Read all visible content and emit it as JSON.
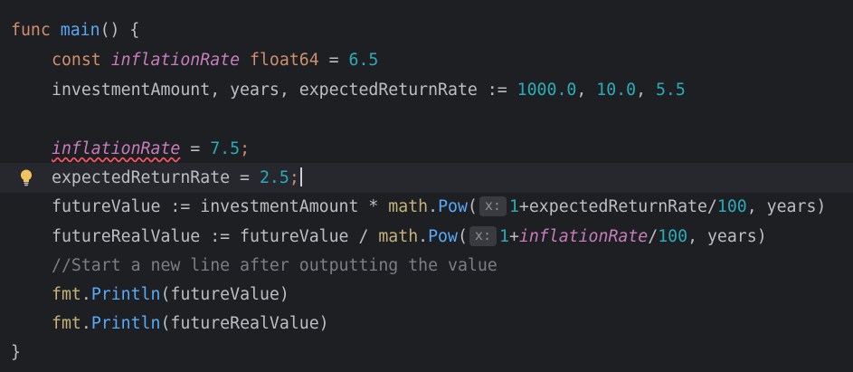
{
  "icons": {
    "quick_fix": "lightbulb-icon"
  },
  "colors": {
    "background": "#1e1f22",
    "current_line": "#26282e",
    "keyword": "#cf8e6d",
    "function_name": "#56a8f5",
    "number": "#2aacb8",
    "package": "#c4b27a",
    "local_var": "#c77dbb",
    "comment": "#7a7e85",
    "error_underline": "#f75464"
  },
  "lines": {
    "l1": {
      "kw": "func",
      "fn": "main",
      "rest": "() {"
    },
    "l2": {
      "kw": "const",
      "name": "inflationRate",
      "type": "float64",
      "op": " = ",
      "val": "6.5"
    },
    "l3": {
      "lhs": "investmentAmount, years, expectedReturnRate := ",
      "v1": "1000.0",
      "sep1": ", ",
      "v2": "10.0",
      "sep2": ", ",
      "v3": "5.5"
    },
    "l5": {
      "name": "inflationRate",
      "op": " = ",
      "val": "7.5",
      "semi": ";"
    },
    "l6": {
      "lhs": "expectedReturnRate = ",
      "val": "2.5",
      "semi": ";"
    },
    "l7": {
      "lhs": "futureValue := investmentAmount * ",
      "pkg": "math",
      "dot": ".",
      "call": "Pow",
      "open": "(",
      "hint": "x:",
      "one": "1",
      "expr": "+expectedReturnRate/",
      "hundred": "100",
      "tail": ", years)"
    },
    "l8": {
      "lhs": "futureRealValue := futureValue / ",
      "pkg": "math",
      "dot": ".",
      "call": "Pow",
      "open": "(",
      "hint": "x:",
      "one": "1",
      "plus": "+",
      "name": "inflationRate",
      "slash": "/",
      "hundred": "100",
      "tail": ", years)"
    },
    "l9": {
      "comment": "//Start a new line after outputting the value"
    },
    "l10": {
      "pkg": "fmt",
      "dot": ".",
      "call": "Println",
      "args": "(futureValue)"
    },
    "l11": {
      "pkg": "fmt",
      "dot": ".",
      "call": "Println",
      "args": "(futureRealValue)"
    },
    "l12": {
      "brace": "}"
    }
  }
}
